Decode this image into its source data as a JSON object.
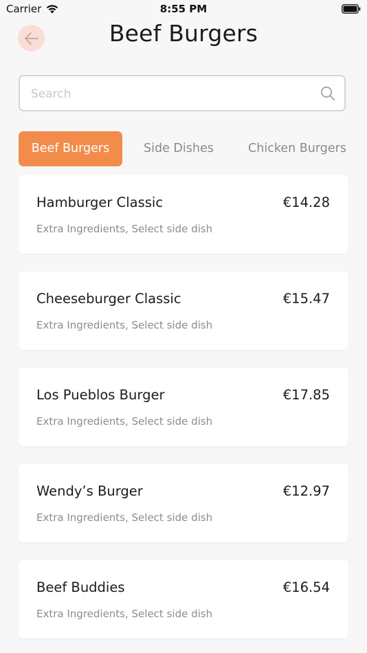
{
  "status_bar": {
    "carrier": "Carrier",
    "time": "8:55 PM"
  },
  "header": {
    "title": "Beef Burgers",
    "back_icon": "arrow-left-icon"
  },
  "search": {
    "placeholder": "Search",
    "value": ""
  },
  "tabs": [
    {
      "label": "Beef Burgers",
      "active": true
    },
    {
      "label": "Side Dishes",
      "active": false
    },
    {
      "label": "Chicken Burgers",
      "active": false
    }
  ],
  "items": [
    {
      "name": "Hamburger Classic",
      "price": "€14.28",
      "description": "Extra Ingredients, Select side dish"
    },
    {
      "name": "Cheeseburger Classic",
      "price": "€15.47",
      "description": "Extra Ingredients, Select side dish"
    },
    {
      "name": "Los Pueblos Burger",
      "price": "€17.85",
      "description": "Extra Ingredients, Select side dish"
    },
    {
      "name": "Wendy’s Burger",
      "price": "€12.97",
      "description": "Extra Ingredients, Select side dish"
    },
    {
      "name": "Beef Buddies",
      "price": "€16.54",
      "description": "Extra Ingredients, Select side dish"
    }
  ],
  "colors": {
    "accent": "#f28c4b",
    "back_button_bg": "#f8ded6",
    "background": "#f7f7f7"
  }
}
